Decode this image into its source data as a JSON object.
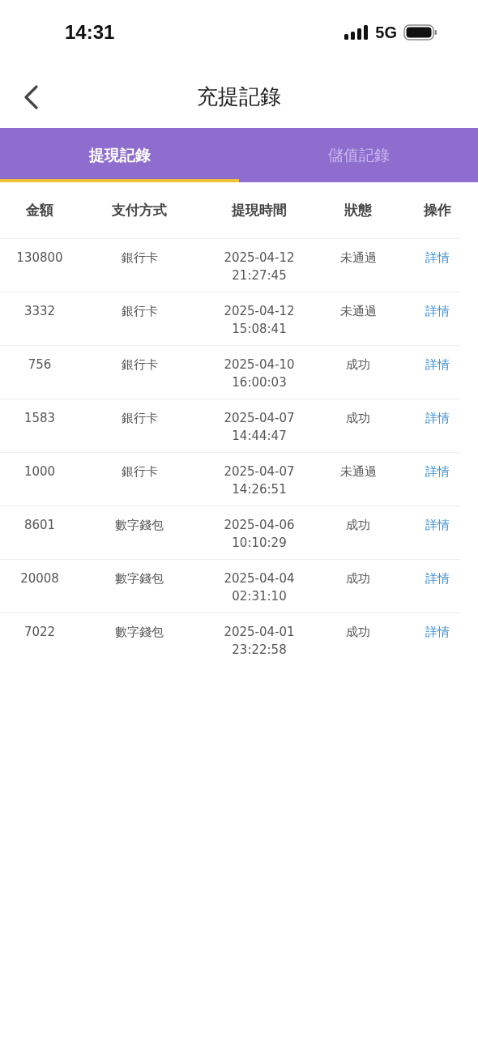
{
  "status_bar": {
    "time": "14:31",
    "network": "5G"
  },
  "nav": {
    "title": "充提記錄"
  },
  "tabs": [
    {
      "label": "提現記錄",
      "selected": true
    },
    {
      "label": "儲值記錄",
      "selected": false
    }
  ],
  "table": {
    "columns": [
      "金額",
      "支付方式",
      "提現時間",
      "狀態",
      "操作"
    ],
    "rows": [
      {
        "amount": "130800",
        "method": "銀行卡",
        "date": "2025-04-12",
        "time": "21:27:45",
        "status": "未通過",
        "action": "詳情"
      },
      {
        "amount": "3332",
        "method": "銀行卡",
        "date": "2025-04-12",
        "time": "15:08:41",
        "status": "未通過",
        "action": "詳情"
      },
      {
        "amount": "756",
        "method": "銀行卡",
        "date": "2025-04-10",
        "time": "16:00:03",
        "status": "成功",
        "action": "詳情"
      },
      {
        "amount": "1583",
        "method": "銀行卡",
        "date": "2025-04-07",
        "time": "14:44:47",
        "status": "成功",
        "action": "詳情"
      },
      {
        "amount": "1000",
        "method": "銀行卡",
        "date": "2025-04-07",
        "time": "14:26:51",
        "status": "未通過",
        "action": "詳情"
      },
      {
        "amount": "8601",
        "method": "數字錢包",
        "date": "2025-04-06",
        "time": "10:10:29",
        "status": "成功",
        "action": "詳情"
      },
      {
        "amount": "20008",
        "method": "數字錢包",
        "date": "2025-04-04",
        "time": "02:31:10",
        "status": "成功",
        "action": "詳情"
      },
      {
        "amount": "7022",
        "method": "數字錢包",
        "date": "2025-04-01",
        "time": "23:22:58",
        "status": "成功",
        "action": "詳情"
      }
    ]
  }
}
